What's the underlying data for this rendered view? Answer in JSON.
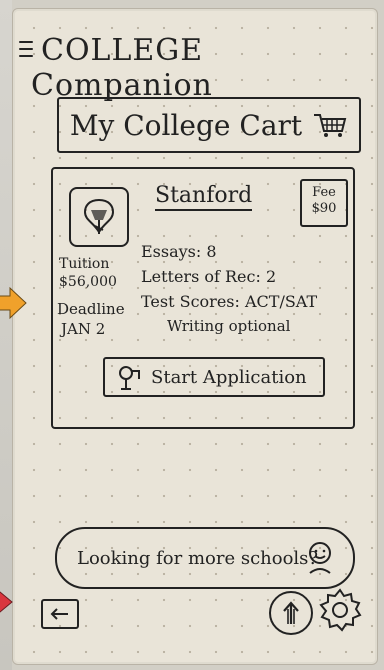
{
  "app": {
    "title": "COLLEGE Companion"
  },
  "cart": {
    "title": "My College Cart"
  },
  "school": {
    "name": "Stanford",
    "fee_label": "Fee",
    "fee_value": "$90",
    "tuition_label": "Tuition",
    "tuition_value": "$56,000",
    "deadline_label": "Deadline",
    "deadline_value": "JAN 2",
    "essays": "Essays: 8",
    "letters": "Letters of Rec: 2",
    "tests": "Test Scores: ACT/SAT",
    "writing": "Writing optional",
    "start_label": "Start Application"
  },
  "more": {
    "label": "Looking for more schools?"
  },
  "colors": {
    "ink": "#222222",
    "paper": "#e9e4d8",
    "orange": "#f0a12b",
    "red": "#d9363e"
  },
  "icons": [
    "menu-icon",
    "cart-icon",
    "school-logo",
    "person-icon",
    "smiley-icon",
    "back-arrow-icon",
    "up-arrow-icon",
    "gear-icon"
  ]
}
